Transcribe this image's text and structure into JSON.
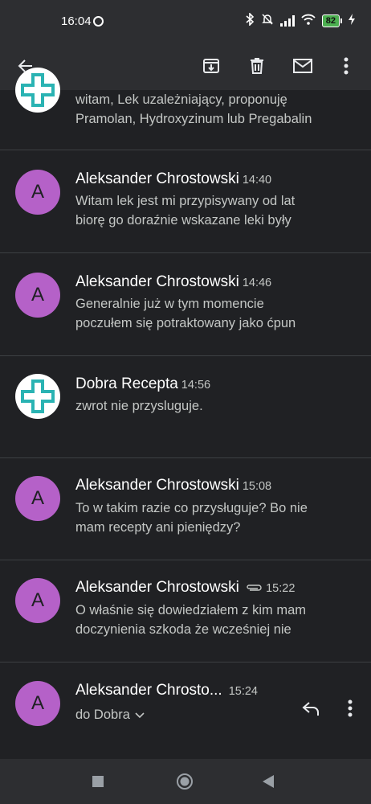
{
  "status_bar": {
    "time": "16:04",
    "battery": "82"
  },
  "messages": [
    {
      "snippet": [
        "witam, Lek uzależniający, proponuję",
        "Pramolan, Hydroxyzinum lub Pregabalin"
      ]
    },
    {
      "sender": "Aleksander Chrostowski",
      "time": "14:40",
      "avatar_letter": "A",
      "snippet": [
        "Witam lek jest mi przypisywany od lat",
        "biorę go doraźnie wskazane leki były"
      ]
    },
    {
      "sender": "Aleksander Chrostowski",
      "time": "14:46",
      "avatar_letter": "A",
      "snippet": [
        "Generalnie już w tym momencie",
        "poczułem się potraktowany jako ćpun"
      ]
    },
    {
      "sender": "Dobra Recepta",
      "time": "14:56",
      "snippet": [
        "zwrot nie przysluguje."
      ]
    },
    {
      "sender": "Aleksander Chrostowski",
      "time": "15:08",
      "avatar_letter": "A",
      "snippet": [
        "To w takim razie co przysługuje? Bo nie",
        "mam recepty ani pieniędzy?"
      ]
    },
    {
      "sender": "Aleksander Chrostowski",
      "time": "15:22",
      "avatar_letter": "A",
      "has_attachment": true,
      "snippet": [
        "O właśnie się dowiedziałem z kim mam",
        "doczynienia szkoda że wcześniej nie"
      ]
    },
    {
      "sender": "Aleksander Chrosto...",
      "time": "15:24",
      "avatar_letter": "A",
      "recipient": "do Dobra"
    }
  ],
  "colors": {
    "background": "#202124",
    "avatar_purple": "#b561c8",
    "logo_teal": "#2ab3b3",
    "battery_green": "#4caf50"
  },
  "icons": [
    "back-arrow-icon",
    "archive-icon",
    "delete-icon",
    "mark-unread-icon",
    "more-vert-icon",
    "attachment-icon",
    "reply-icon",
    "chevron-down-icon",
    "nav-recents-icon",
    "nav-home-icon",
    "nav-back-icon"
  ]
}
